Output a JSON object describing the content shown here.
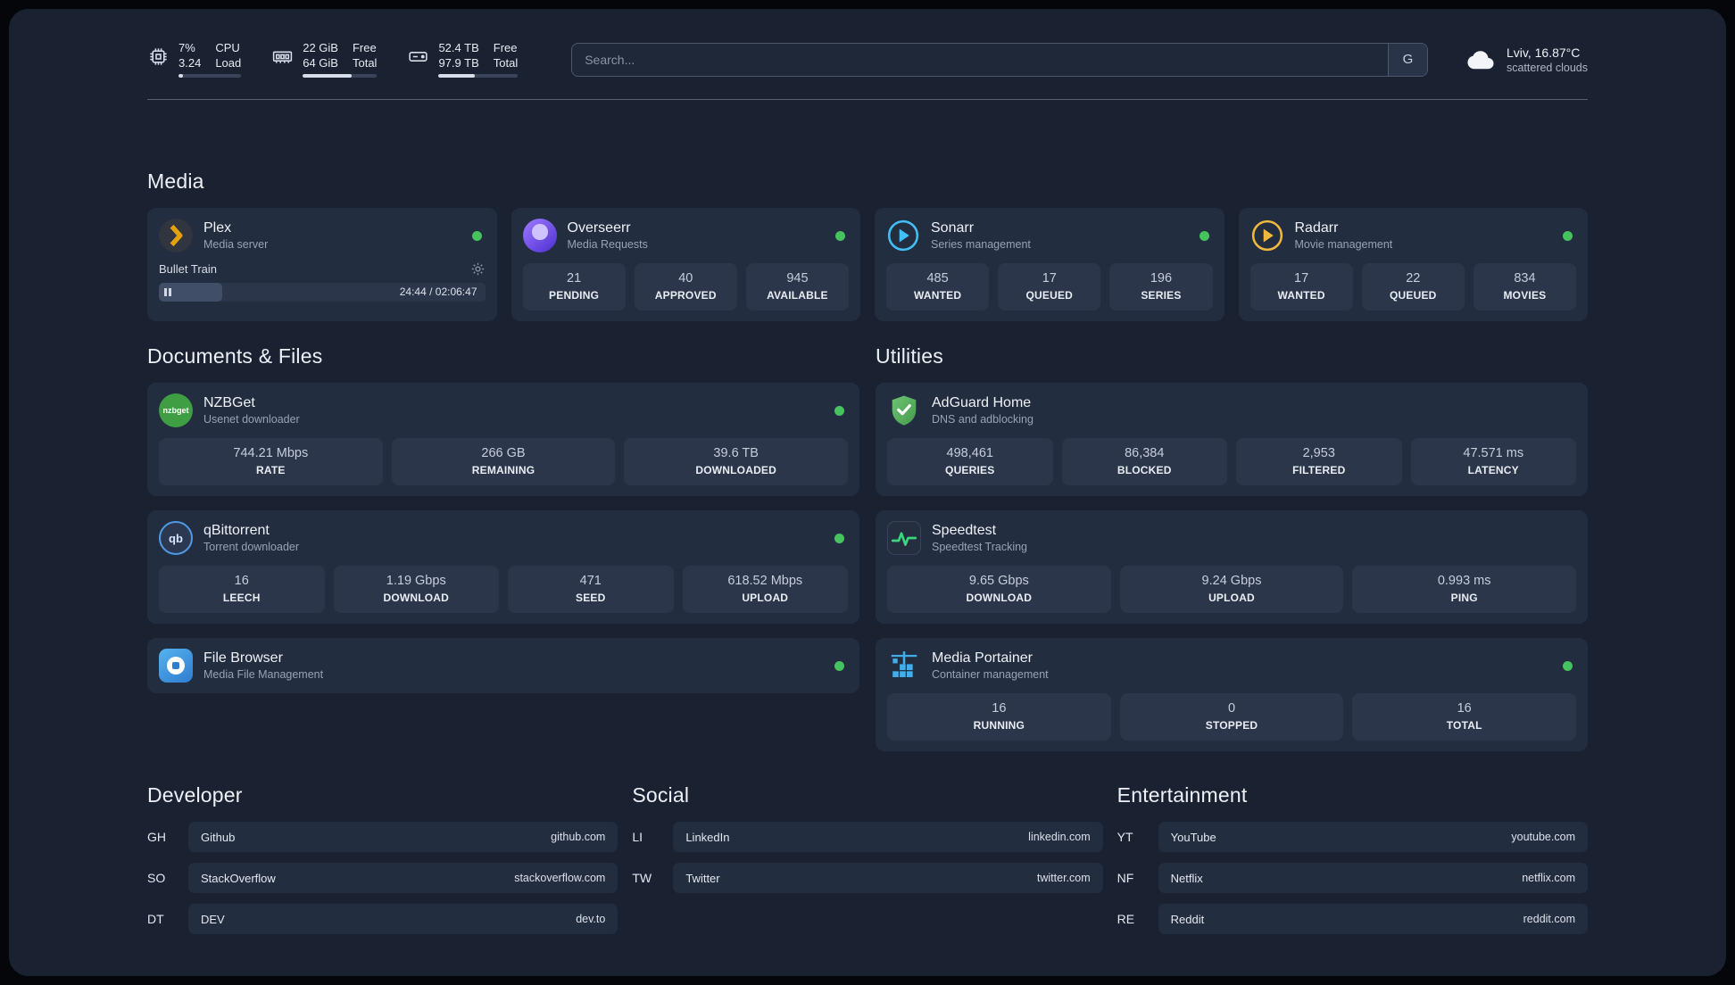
{
  "colors": {
    "status_online": "#46c35f",
    "portainer_blue": "#41aee9",
    "plex_amber": "#e5a00d",
    "sonarr_blue": "#42bff5",
    "radarr_amber": "#f0b83d",
    "adguard_green": "#57b65c",
    "speedtest_green": "#3bd57f"
  },
  "topbar": {
    "cpu": {
      "value1": "7%",
      "value2": "3.24",
      "label1": "CPU",
      "label2": "Load",
      "usage_percent": 7
    },
    "ram": {
      "value1": "22 GiB",
      "value2": "64 GiB",
      "label1": "Free",
      "label2": "Total",
      "usage_percent": 66
    },
    "disk": {
      "value1": "52.4 TB",
      "value2": "97.9 TB",
      "label1": "Free",
      "label2": "Total",
      "usage_percent": 46
    },
    "search": {
      "placeholder": "Search...",
      "engine_button": "G"
    },
    "weather": {
      "location": "Lviv, 16.87°C",
      "condition": "scattered clouds"
    }
  },
  "media": {
    "title": "Media",
    "plex": {
      "name": "Plex",
      "subtitle": "Media server",
      "now_playing": {
        "title": "Bullet Train",
        "time_display": "24:44 / 02:06:47",
        "progress_percent": 19.5
      }
    },
    "overseerr": {
      "name": "Overseerr",
      "subtitle": "Media Requests",
      "stats": [
        {
          "value": "21",
          "label": "PENDING"
        },
        {
          "value": "40",
          "label": "APPROVED"
        },
        {
          "value": "945",
          "label": "AVAILABLE"
        }
      ]
    },
    "sonarr": {
      "name": "Sonarr",
      "subtitle": "Series management",
      "stats": [
        {
          "value": "485",
          "label": "WANTED"
        },
        {
          "value": "17",
          "label": "QUEUED"
        },
        {
          "value": "196",
          "label": "SERIES"
        }
      ]
    },
    "radarr": {
      "name": "Radarr",
      "subtitle": "Movie management",
      "stats": [
        {
          "value": "17",
          "label": "WANTED"
        },
        {
          "value": "22",
          "label": "QUEUED"
        },
        {
          "value": "834",
          "label": "MOVIES"
        }
      ]
    }
  },
  "documents": {
    "title": "Documents & Files",
    "nzbget": {
      "name": "NZBGet",
      "subtitle": "Usenet downloader",
      "icon_text": "nzbget",
      "stats": [
        {
          "value": "744.21 Mbps",
          "label": "RATE"
        },
        {
          "value": "266 GB",
          "label": "REMAINING"
        },
        {
          "value": "39.6 TB",
          "label": "DOWNLOADED"
        }
      ]
    },
    "qbittorrent": {
      "name": "qBittorrent",
      "subtitle": "Torrent downloader",
      "icon_text": "qb",
      "stats": [
        {
          "value": "16",
          "label": "LEECH"
        },
        {
          "value": "1.19 Gbps",
          "label": "DOWNLOAD"
        },
        {
          "value": "471",
          "label": "SEED"
        },
        {
          "value": "618.52 Mbps",
          "label": "UPLOAD"
        }
      ]
    },
    "filebrowser": {
      "name": "File Browser",
      "subtitle": "Media File Management"
    }
  },
  "utilities": {
    "title": "Utilities",
    "adguard": {
      "name": "AdGuard Home",
      "subtitle": "DNS and adblocking",
      "stats": [
        {
          "value": "498,461",
          "label": "QUERIES"
        },
        {
          "value": "86,384",
          "label": "BLOCKED"
        },
        {
          "value": "2,953",
          "label": "FILTERED"
        },
        {
          "value": "47.571 ms",
          "label": "LATENCY"
        }
      ]
    },
    "speedtest": {
      "name": "Speedtest",
      "subtitle": "Speedtest Tracking",
      "stats": [
        {
          "value": "9.65 Gbps",
          "label": "DOWNLOAD"
        },
        {
          "value": "9.24 Gbps",
          "label": "UPLOAD"
        },
        {
          "value": "0.993 ms",
          "label": "PING"
        }
      ]
    },
    "portainer": {
      "name": "Media Portainer",
      "subtitle": "Container management",
      "stats": [
        {
          "value": "16",
          "label": "RUNNING"
        },
        {
          "value": "0",
          "label": "STOPPED"
        },
        {
          "value": "16",
          "label": "TOTAL"
        }
      ]
    }
  },
  "bookmarks": {
    "developer": {
      "title": "Developer",
      "items": [
        {
          "abbr": "GH",
          "name": "Github",
          "url": "github.com"
        },
        {
          "abbr": "SO",
          "name": "StackOverflow",
          "url": "stackoverflow.com"
        },
        {
          "abbr": "DT",
          "name": "DEV",
          "url": "dev.to"
        }
      ]
    },
    "social": {
      "title": "Social",
      "items": [
        {
          "abbr": "LI",
          "name": "LinkedIn",
          "url": "linkedin.com"
        },
        {
          "abbr": "TW",
          "name": "Twitter",
          "url": "twitter.com"
        }
      ]
    },
    "entertainment": {
      "title": "Entertainment",
      "items": [
        {
          "abbr": "YT",
          "name": "YouTube",
          "url": "youtube.com"
        },
        {
          "abbr": "NF",
          "name": "Netflix",
          "url": "netflix.com"
        },
        {
          "abbr": "RE",
          "name": "Reddit",
          "url": "reddit.com"
        }
      ]
    }
  }
}
